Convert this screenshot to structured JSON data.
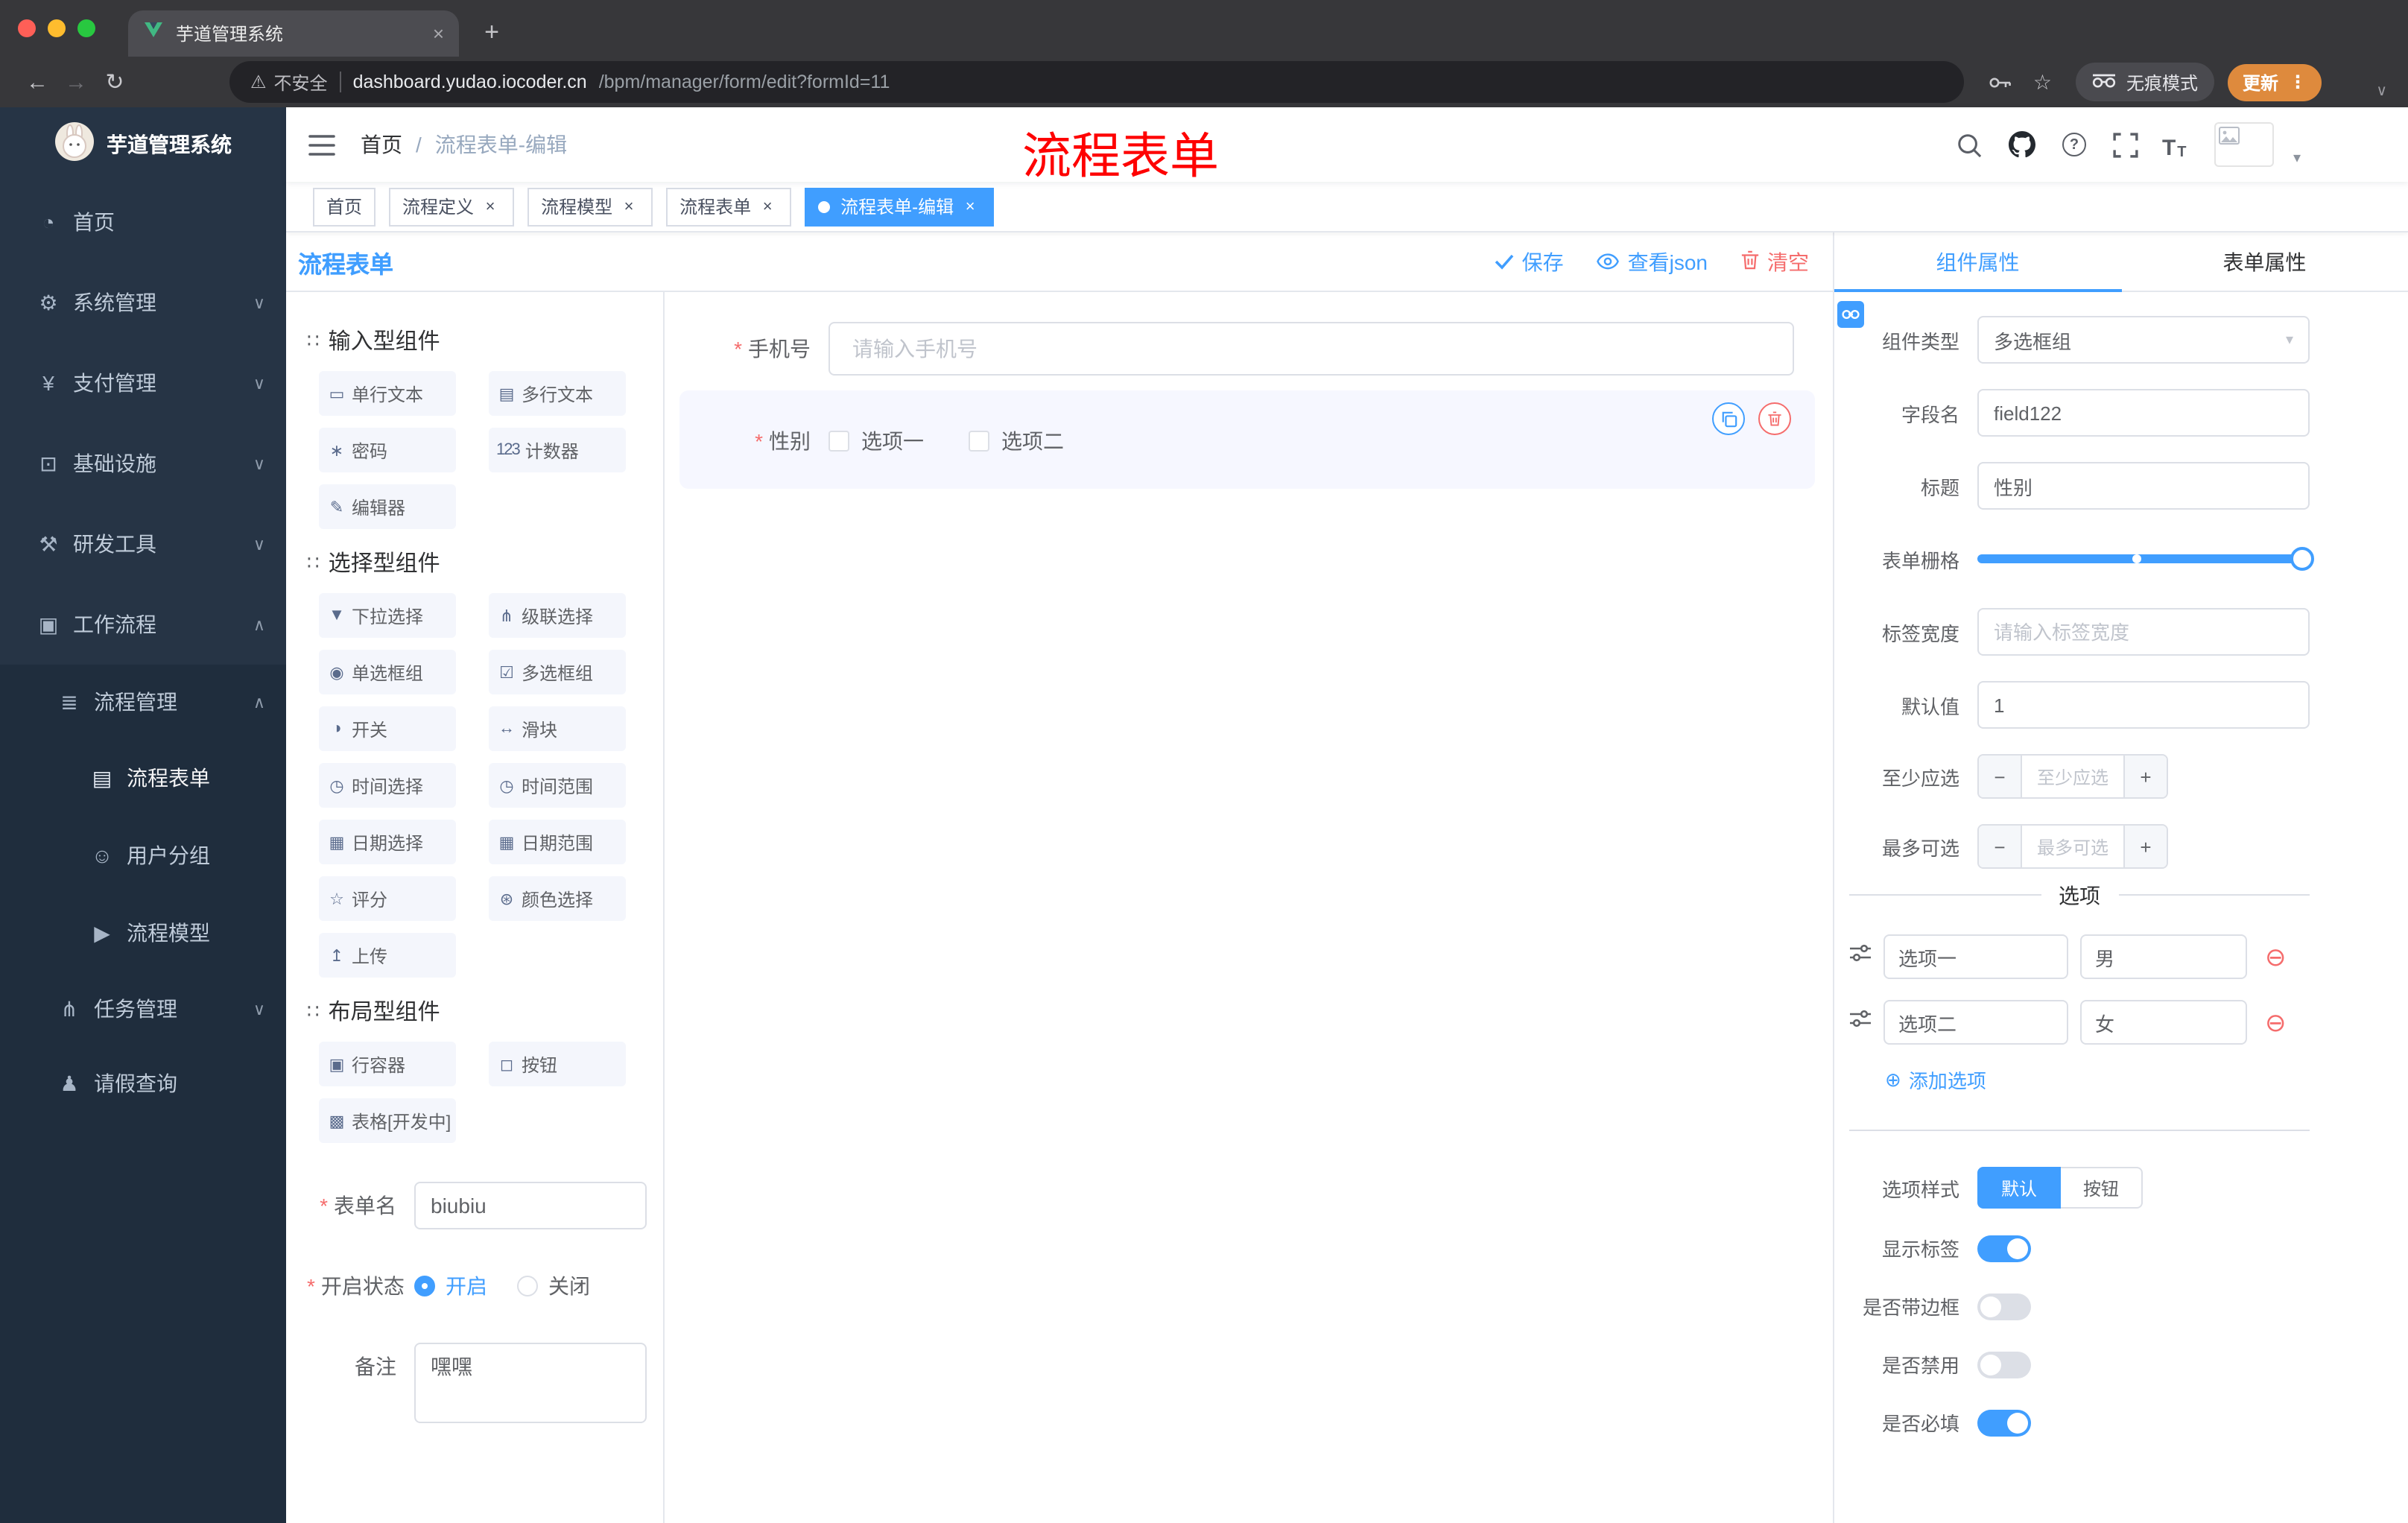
{
  "colors": {
    "accent": "#409EFF",
    "danger": "#F56C6C",
    "annotation": "#FE0000",
    "update_pill": "#DE8A3D"
  },
  "icons": {
    "chevron_down": "∨",
    "chevron_up": "∧",
    "close": "×",
    "plus": "+",
    "minus": "−",
    "back": "←",
    "forward": "→",
    "reload": "↻",
    "warning": "⚠",
    "star": "☆",
    "kebab": "⋮",
    "caret_down": "▾",
    "remove_circle": "⊖",
    "add_circle": "⊕",
    "section": "∷",
    "question": "?",
    "text_size_big": "T",
    "text_size_small": "T"
  },
  "browser": {
    "tab_title": "芋道管理系统",
    "security_label": "不安全",
    "url_domain": "dashboard.yudao.iocoder.cn",
    "url_path": "/bpm/manager/form/edit?formId=11",
    "incognito_label": "无痕模式",
    "update_label": "更新"
  },
  "sidebar": {
    "logo_title": "芋道管理系统",
    "items": [
      {
        "label": "首页",
        "glyph": "◔"
      },
      {
        "label": "系统管理",
        "glyph": "⚙"
      },
      {
        "label": "支付管理",
        "glyph": "¥"
      },
      {
        "label": "基础设施",
        "glyph": "⊡"
      },
      {
        "label": "研发工具",
        "glyph": "⚒"
      },
      {
        "label": "工作流程",
        "glyph": "▣"
      },
      {
        "label": "流程管理",
        "glyph": "≣"
      },
      {
        "label": "流程表单",
        "glyph": "▤"
      },
      {
        "label": "用户分组",
        "glyph": "☺"
      },
      {
        "label": "流程模型",
        "glyph": "▶"
      },
      {
        "label": "任务管理",
        "glyph": "⋔"
      },
      {
        "label": "请假查询",
        "glyph": "♟"
      }
    ]
  },
  "navbar": {
    "breadcrumb_home": "首页",
    "breadcrumb_separator": "/",
    "breadcrumb_current": "流程表单-编辑",
    "annotation": "流程表单"
  },
  "tags": [
    {
      "label": "首页"
    },
    {
      "label": "流程定义"
    },
    {
      "label": "流程模型"
    },
    {
      "label": "流程表单"
    },
    {
      "label": "流程表单-编辑"
    }
  ],
  "workspace": {
    "title": "流程表单",
    "save_label": "保存",
    "view_json_label": "查看json",
    "clear_label": "清空"
  },
  "components_panel": {
    "sections": [
      {
        "title": "输入型组件",
        "items": [
          {
            "label": "单行文本",
            "glyph": "▭"
          },
          {
            "label": "多行文本",
            "glyph": "▤"
          },
          {
            "label": "密码",
            "glyph": "∗"
          },
          {
            "label": "计数器",
            "glyph": "123"
          },
          {
            "label": "编辑器",
            "glyph": "✎"
          }
        ]
      },
      {
        "title": "选择型组件",
        "items": [
          {
            "label": "下拉选择",
            "glyph": "▼"
          },
          {
            "label": "级联选择",
            "glyph": "⋔"
          },
          {
            "label": "单选框组",
            "glyph": "◉"
          },
          {
            "label": "多选框组",
            "glyph": "☑"
          },
          {
            "label": "开关",
            "glyph": "◑"
          },
          {
            "label": "滑块",
            "glyph": "↔"
          },
          {
            "label": "时间选择",
            "glyph": "◷"
          },
          {
            "label": "时间范围",
            "glyph": "◷"
          },
          {
            "label": "日期选择",
            "glyph": "▦"
          },
          {
            "label": "日期范围",
            "glyph": "▦"
          },
          {
            "label": "评分",
            "glyph": "☆"
          },
          {
            "label": "颜色选择",
            "glyph": "⊛"
          },
          {
            "label": "上传",
            "glyph": "↥"
          }
        ]
      },
      {
        "title": "布局型组件",
        "items": [
          {
            "label": "行容器",
            "glyph": "▣"
          },
          {
            "label": "按钮",
            "glyph": "◻"
          },
          {
            "label": "表格[开发中]",
            "glyph": "▩"
          }
        ]
      }
    ],
    "form": {
      "name_label": "表单名",
      "name_value": "biubiu",
      "status_label": "开启状态",
      "status_on": "开启",
      "status_off": "关闭",
      "remark_label": "备注",
      "remark_value": "嘿嘿"
    }
  },
  "canvas": {
    "phone_label": "手机号",
    "phone_placeholder": "请输入手机号",
    "gender_label": "性别",
    "gender_option1": "选项一",
    "gender_option2": "选项二"
  },
  "properties": {
    "tab_component": "组件属性",
    "tab_form": "表单属性",
    "component_type_label": "组件类型",
    "component_type_value": "多选框组",
    "field_name_label": "字段名",
    "field_name_value": "field122",
    "title_label": "标题",
    "title_value": "性别",
    "grid_label": "表单栅格",
    "label_width_label": "标签宽度",
    "label_width_placeholder": "请输入标签宽度",
    "default_label": "默认值",
    "default_value": "1",
    "min_label": "至少应选",
    "min_placeholder": "至少应选",
    "max_label": "最多可选",
    "max_placeholder": "最多可选",
    "options_title": "选项",
    "options": [
      {
        "label": "选项一",
        "value": "男"
      },
      {
        "label": "选项二",
        "value": "女"
      }
    ],
    "add_option_label": "添加选项",
    "style_label": "选项样式",
    "style_default": "默认",
    "style_button": "按钮",
    "switch_show_label": "显示标签",
    "switch_border": "是否带边框",
    "switch_disabled": "是否禁用",
    "switch_required": "是否必填"
  }
}
